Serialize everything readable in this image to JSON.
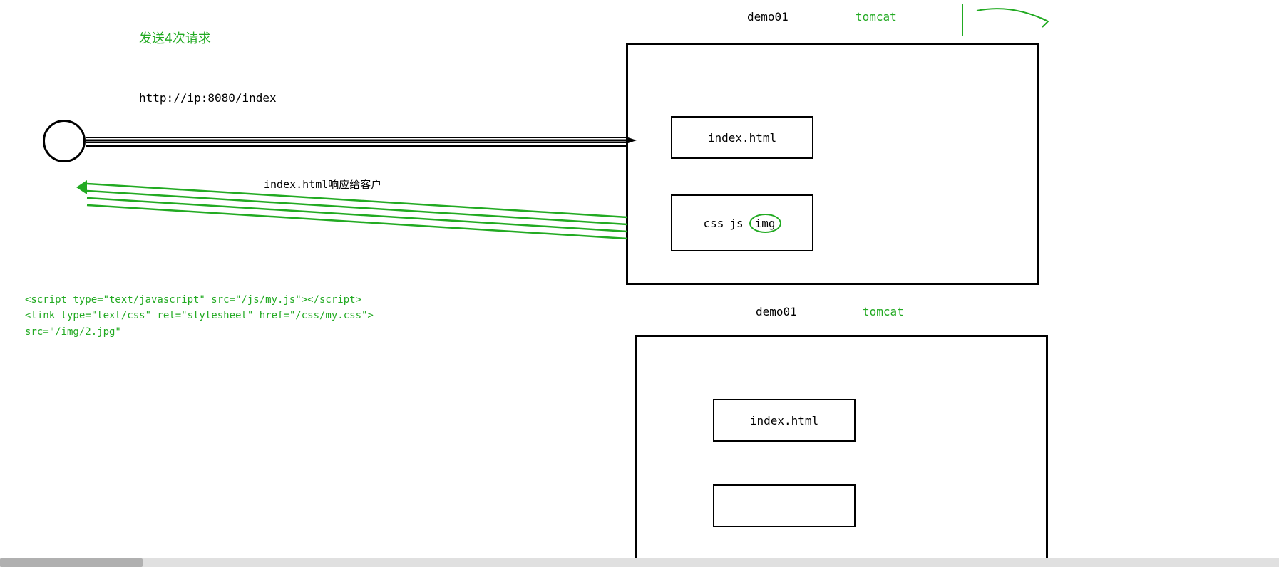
{
  "top_section": {
    "send_requests_label": "发送4次请求",
    "url_label": "http://ip:8080/index",
    "response_label": "index.html响应给客户",
    "demo01_top_label": "demo01",
    "tomcat_top_label": "tomcat",
    "index_html_top_label": "index.html",
    "css_label": "css",
    "js_label": "js",
    "img_label": "img"
  },
  "code_section": {
    "line1": "<script type=\"text/javascript\" src=\"/js/my.js\"></script>",
    "line2": "<link type=\"text/css\" rel=\"stylesheet\" href=\"/css/my.css\">",
    "line3": "src=\"/img/2.jpg\""
  },
  "bottom_section": {
    "demo01_bottom_label": "demo01",
    "tomcat_bottom_label": "tomcat",
    "index_html_bottom_label": "index.html"
  }
}
